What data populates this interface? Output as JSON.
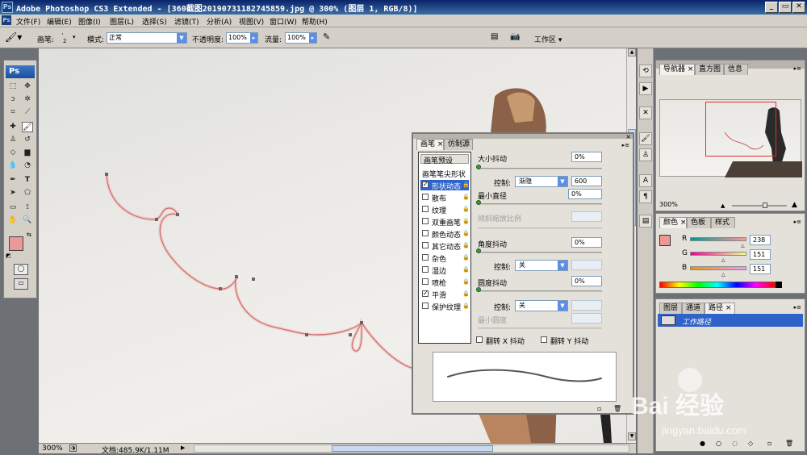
{
  "window": {
    "app_icon": "Ps",
    "title": "Adobe Photoshop CS3 Extended - [360截图20190731182745859.jpg @ 300% (图层 1, RGB/8)]",
    "min": "_",
    "restore": "▭",
    "close": "✕"
  },
  "menu": [
    "文件(F)",
    "编辑(E)",
    "图像(I)",
    "图层(L)",
    "选择(S)",
    "滤镜(T)",
    "分析(A)",
    "视图(V)",
    "窗口(W)",
    "帮助(H)"
  ],
  "options": {
    "brush_label": "画笔:",
    "brush_size": "2",
    "mode_label": "模式:",
    "mode_value": "正常",
    "opacity_label": "不透明度:",
    "opacity_value": "100%",
    "flow_label": "流量:",
    "flow_value": "100%",
    "workspace": "工作区 ▾"
  },
  "toolbox": {
    "logo": "Ps"
  },
  "status": {
    "zoom": "300%",
    "doc": "文档:485.9K/1.11M"
  },
  "navigator": {
    "tabs": [
      "导航器",
      "直方图",
      "信息"
    ],
    "zoom": "300%"
  },
  "color": {
    "tabs": [
      "颜色",
      "色板",
      "样式"
    ],
    "channels": [
      {
        "label": "R",
        "value": "238",
        "fraction": 0.933
      },
      {
        "label": "G",
        "value": "151",
        "fraction": 0.592
      },
      {
        "label": "B",
        "value": "151",
        "fraction": 0.592
      }
    ],
    "foreground": "#ee9797"
  },
  "layers": {
    "tabs": [
      "图层",
      "通道",
      "路径"
    ],
    "path_item": "工作路径"
  },
  "brush_panel": {
    "tabs": [
      "画笔",
      "仿制源"
    ],
    "presets_btn": "画笔预设",
    "tip_shape": "画笔笔尖形状",
    "options": [
      {
        "label": "形状动态",
        "checked": true,
        "selected": true
      },
      {
        "label": "散布",
        "checked": false
      },
      {
        "label": "纹理",
        "checked": false
      },
      {
        "label": "双重画笔",
        "checked": false
      },
      {
        "label": "颜色动态",
        "checked": false
      },
      {
        "label": "其它动态",
        "checked": false
      },
      {
        "label": "杂色",
        "checked": false
      },
      {
        "label": "湿边",
        "checked": false
      },
      {
        "label": "喷枪",
        "checked": false
      },
      {
        "label": "平滑",
        "checked": true
      },
      {
        "label": "保护纹理",
        "checked": false
      }
    ],
    "size_jitter_label": "大小抖动",
    "size_jitter_value": "0%",
    "control_label": "控制:",
    "control1_value": "渐隐",
    "fade_steps": "600",
    "min_diameter_label": "最小直径",
    "min_diameter_value": "0%",
    "tilt_scale_label": "倾斜缩放比例",
    "angle_jitter_label": "角度抖动",
    "angle_jitter_value": "0%",
    "control2_value": "关",
    "roundness_jitter_label": "圆度抖动",
    "roundness_jitter_value": "0%",
    "control3_value": "关",
    "min_roundness_label": "最小圆度",
    "flip_x": "翻转 X 抖动",
    "flip_y": "翻转 Y 抖动"
  },
  "watermark": {
    "brand": "Bai  经验",
    "url": "jingyan.baidu.com"
  }
}
